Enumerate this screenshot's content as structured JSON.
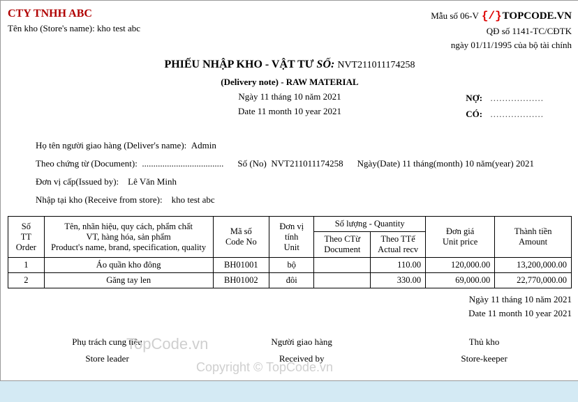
{
  "header": {
    "company": "CTY TNHH ABC",
    "store_label": "Tên kho (Store's name):",
    "store_name": "kho test abc",
    "form_no": "Mẫu số 06-V",
    "decision": "QĐ số 1141-TC/CĐTK",
    "issue_line": "ngày 01/11/1995 của bộ tài chính",
    "logo_text": "TOPCODE.VN"
  },
  "title": {
    "main": "PHIẾU NHẬP KHO - VẬT TƯ",
    "so_label": "SỐ:",
    "number": "NVT211011174258",
    "subtitle": "(Delivery note) - RAW MATERIAL",
    "date_vn": "Ngày 11 tháng 10 năm 2021",
    "date_en": "Date 11 month 10 year 2021"
  },
  "debit_credit": {
    "no": "NỢ:",
    "co": "CÓ:",
    "dots": ".................."
  },
  "info": {
    "deliverer_lbl": "Họ tên người giao hàng (Deliver's name):",
    "deliverer": "Admin",
    "document_lbl": "Theo chứng từ (Document):",
    "document_dots": "....................................",
    "sono_lbl": "Số (No)",
    "sono": "NVT211011174258",
    "date_lbl": "Ngày(Date) 11 tháng(month) 10 năm(year) 2021",
    "issuedby_lbl": "Đơn vị cấp(Issued by):",
    "issuedby": "Lê Văn Minh",
    "recvstore_lbl": "Nhập tại kho (Receive from store):",
    "recvstore": "kho test abc"
  },
  "table": {
    "headers": {
      "order": "Số\nTT\nOrder",
      "name": "Tên, nhãn hiệu, quy cách, phẩm chất\nVT, hàng hóa, sản phẩm\nProduct's name, brand, specification, quality",
      "code": "Mã số\nCode No",
      "unit": "Đơn vị\ntính\nUnit",
      "qty_group": "Số lượng - Quantity",
      "qty_doc": "Theo CTừ\nDocument",
      "qty_act": "Theo TTế\nActual recv",
      "price": "Đơn giá\nUnit price",
      "amount": "Thành tiền\nAmount"
    },
    "rows": [
      {
        "order": "1",
        "name": "Áo quần kho đông",
        "code": "BH01001",
        "unit": "bộ",
        "qdoc": "",
        "qact": "110.00",
        "price": "120,000.00",
        "amount": "13,200,000.00"
      },
      {
        "order": "2",
        "name": "Găng tay len",
        "code": "BH01002",
        "unit": "đôi",
        "qdoc": "",
        "qact": "330.00",
        "price": "69,000.00",
        "amount": "22,770,000.00"
      }
    ]
  },
  "footer": {
    "date_vn": "Ngày 11 tháng 10 năm 2021",
    "date_en": "Date 11 month 10 year 2021",
    "sign1_vn": "Phụ trách cung tiêu",
    "sign1_en": "Store leader",
    "sign2_vn": "Người giao hàng",
    "sign2_en": "Received by",
    "sign3_vn": "Thủ kho",
    "sign3_en": "Store-keeper"
  },
  "watermark": {
    "w1": "TopCode.vn",
    "w2": "Copyright © TopCode.vn"
  }
}
